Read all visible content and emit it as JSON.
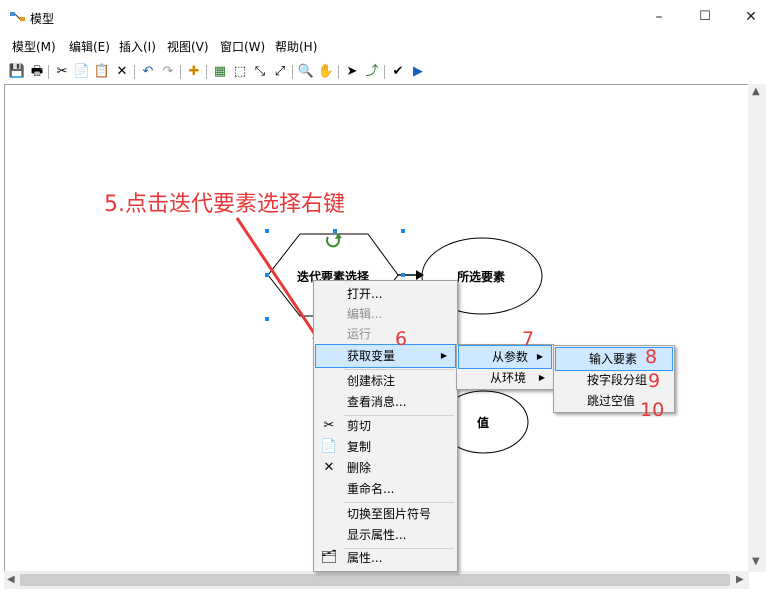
{
  "window": {
    "title": "模型",
    "minimize": "–",
    "maximize": "☐",
    "close": "✕"
  },
  "menubar": [
    "模型(M)",
    "编辑(E)",
    "插入(I)",
    "视图(V)",
    "窗口(W)",
    "帮助(H)"
  ],
  "toolbar": {
    "icons": [
      "save-icon",
      "print-icon",
      "cut-icon",
      "copy-icon",
      "paste-icon",
      "delete-icon",
      "undo-icon",
      "redo-icon",
      "add-data-icon",
      "auto-layout-icon",
      "full-extent-icon",
      "fixed-zoom-in-icon",
      "fixed-zoom-out-icon",
      "zoom-in-icon",
      "pan-icon",
      "select-icon",
      "connect-icon",
      "validate-icon",
      "run-icon"
    ],
    "glyphs": [
      "💾",
      "🖶",
      "✂",
      "📄",
      "📋",
      "✕",
      "↶",
      "↷",
      "✚",
      "▦",
      "⬚",
      "⤡",
      "⤢",
      "🔍",
      "✋",
      "➤",
      "⤴",
      "✔",
      "▶"
    ]
  },
  "diagram": {
    "iterator_label": "迭代要素选择",
    "selected_label": "所选要素",
    "value_label": "值"
  },
  "annotations": {
    "step5": "5.点击迭代要素选择右键",
    "n6": "6",
    "n7": "7",
    "n8": "8",
    "n9": "9",
    "n10": "10"
  },
  "context_menu": {
    "items": [
      {
        "label": "打开...",
        "state": "normal"
      },
      {
        "label": "编辑...",
        "state": "disabled"
      },
      {
        "label": "运行",
        "state": "disabled"
      },
      {
        "label": "获取变量",
        "state": "highlighted"
      },
      {
        "label": "创建标注",
        "state": "normal"
      },
      {
        "label": "查看消息...",
        "state": "normal"
      },
      {
        "label": "剪切",
        "state": "normal",
        "icon": "cut-icon"
      },
      {
        "label": "复制",
        "state": "normal",
        "icon": "copy-icon"
      },
      {
        "label": "删除",
        "state": "normal",
        "icon": "delete-icon"
      },
      {
        "label": "重命名...",
        "state": "normal"
      },
      {
        "label": "切换至图片符号",
        "state": "normal"
      },
      {
        "label": "显示属性...",
        "state": "normal"
      },
      {
        "label": "属性...",
        "state": "normal",
        "icon": "properties-icon"
      }
    ]
  },
  "submenu1": {
    "items": [
      "从参数",
      "从环境"
    ]
  },
  "submenu2": {
    "items": [
      "输入要素",
      "按字段分组",
      "跳过空值"
    ]
  },
  "colors": {
    "annotation": "#e8393a",
    "highlight": "#cde8ff",
    "highlight_border": "#3399ff",
    "handle": "#1e88e5",
    "loop": "#3a8c2f"
  }
}
